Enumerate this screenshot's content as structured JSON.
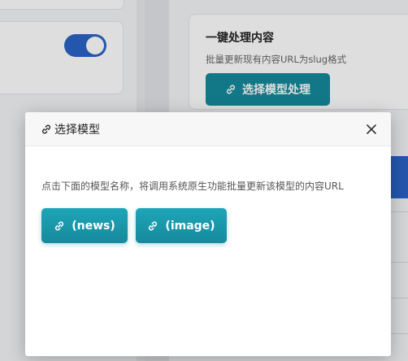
{
  "background": {
    "toggle_state": "on",
    "card": {
      "title": "一键处理内容",
      "description": "批量更新现有内容URL为slug格式",
      "button_label": "选择模型处理"
    }
  },
  "modal": {
    "title": "选择模型",
    "description": "点击下面的模型名称，将调用系统原生功能批量更新该模型的内容URL",
    "models": [
      {
        "label": "(news)"
      },
      {
        "label": "(image)"
      }
    ]
  },
  "colors": {
    "accent": "#15899a",
    "toggle_blue": "#2a63c7"
  },
  "icons": {
    "title_icon": "link-icon",
    "button_icon": "link-icon",
    "close_icon": "close-icon"
  }
}
